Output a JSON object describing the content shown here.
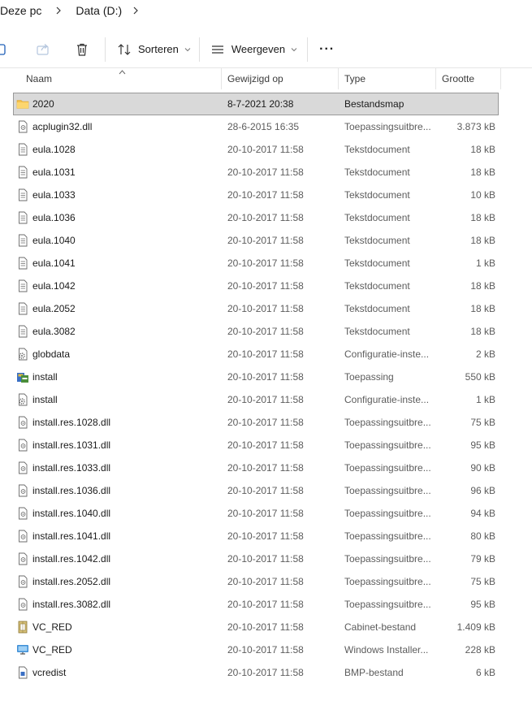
{
  "breadcrumb": {
    "items": [
      "Deze pc",
      "Data (D:)"
    ]
  },
  "toolbar": {
    "sort_label": "Sorteren",
    "view_label": "Weergeven",
    "more_label": "···"
  },
  "columns": {
    "name": "Naam",
    "modified": "Gewijzigd op",
    "type": "Type",
    "size": "Grootte"
  },
  "colors": {
    "folder": "#f5c04a",
    "selection": "#d9d9d9",
    "icon_gray": "#6b6b6b"
  },
  "files": [
    {
      "name": "2020",
      "modified": "8-7-2021 20:38",
      "type": "Bestandsmap",
      "size": "",
      "icon": "folder-icon",
      "selected": true
    },
    {
      "name": "acplugin32.dll",
      "modified": "28-6-2015 16:35",
      "type": "Toepassingsuitbre...",
      "size": "3.873 kB",
      "icon": "dll-file-icon"
    },
    {
      "name": "eula.1028",
      "modified": "20-10-2017 11:58",
      "type": "Tekstdocument",
      "size": "18 kB",
      "icon": "text-file-icon"
    },
    {
      "name": "eula.1031",
      "modified": "20-10-2017 11:58",
      "type": "Tekstdocument",
      "size": "18 kB",
      "icon": "text-file-icon"
    },
    {
      "name": "eula.1033",
      "modified": "20-10-2017 11:58",
      "type": "Tekstdocument",
      "size": "10 kB",
      "icon": "text-file-icon"
    },
    {
      "name": "eula.1036",
      "modified": "20-10-2017 11:58",
      "type": "Tekstdocument",
      "size": "18 kB",
      "icon": "text-file-icon"
    },
    {
      "name": "eula.1040",
      "modified": "20-10-2017 11:58",
      "type": "Tekstdocument",
      "size": "18 kB",
      "icon": "text-file-icon"
    },
    {
      "name": "eula.1041",
      "modified": "20-10-2017 11:58",
      "type": "Tekstdocument",
      "size": "1 kB",
      "icon": "text-file-icon"
    },
    {
      "name": "eula.1042",
      "modified": "20-10-2017 11:58",
      "type": "Tekstdocument",
      "size": "18 kB",
      "icon": "text-file-icon"
    },
    {
      "name": "eula.2052",
      "modified": "20-10-2017 11:58",
      "type": "Tekstdocument",
      "size": "18 kB",
      "icon": "text-file-icon"
    },
    {
      "name": "eula.3082",
      "modified": "20-10-2017 11:58",
      "type": "Tekstdocument",
      "size": "18 kB",
      "icon": "text-file-icon"
    },
    {
      "name": "globdata",
      "modified": "20-10-2017 11:58",
      "type": "Configuratie-inste...",
      "size": "2 kB",
      "icon": "config-file-icon"
    },
    {
      "name": "install",
      "modified": "20-10-2017 11:58",
      "type": "Toepassing",
      "size": "550 kB",
      "icon": "installer-app-icon"
    },
    {
      "name": "install",
      "modified": "20-10-2017 11:58",
      "type": "Configuratie-inste...",
      "size": "1 kB",
      "icon": "config-file-icon"
    },
    {
      "name": "install.res.1028.dll",
      "modified": "20-10-2017 11:58",
      "type": "Toepassingsuitbre...",
      "size": "75 kB",
      "icon": "dll-file-icon"
    },
    {
      "name": "install.res.1031.dll",
      "modified": "20-10-2017 11:58",
      "type": "Toepassingsuitbre...",
      "size": "95 kB",
      "icon": "dll-file-icon"
    },
    {
      "name": "install.res.1033.dll",
      "modified": "20-10-2017 11:58",
      "type": "Toepassingsuitbre...",
      "size": "90 kB",
      "icon": "dll-file-icon"
    },
    {
      "name": "install.res.1036.dll",
      "modified": "20-10-2017 11:58",
      "type": "Toepassingsuitbre...",
      "size": "96 kB",
      "icon": "dll-file-icon"
    },
    {
      "name": "install.res.1040.dll",
      "modified": "20-10-2017 11:58",
      "type": "Toepassingsuitbre...",
      "size": "94 kB",
      "icon": "dll-file-icon"
    },
    {
      "name": "install.res.1041.dll",
      "modified": "20-10-2017 11:58",
      "type": "Toepassingsuitbre...",
      "size": "80 kB",
      "icon": "dll-file-icon"
    },
    {
      "name": "install.res.1042.dll",
      "modified": "20-10-2017 11:58",
      "type": "Toepassingsuitbre...",
      "size": "79 kB",
      "icon": "dll-file-icon"
    },
    {
      "name": "install.res.2052.dll",
      "modified": "20-10-2017 11:58",
      "type": "Toepassingsuitbre...",
      "size": "75 kB",
      "icon": "dll-file-icon"
    },
    {
      "name": "install.res.3082.dll",
      "modified": "20-10-2017 11:58",
      "type": "Toepassingsuitbre...",
      "size": "95 kB",
      "icon": "dll-file-icon"
    },
    {
      "name": "VC_RED",
      "modified": "20-10-2017 11:58",
      "type": "Cabinet-bestand",
      "size": "1.409 kB",
      "icon": "cabinet-file-icon"
    },
    {
      "name": "VC_RED",
      "modified": "20-10-2017 11:58",
      "type": "Windows Installer...",
      "size": "228 kB",
      "icon": "msi-file-icon"
    },
    {
      "name": "vcredist",
      "modified": "20-10-2017 11:58",
      "type": "BMP-bestand",
      "size": "6 kB",
      "icon": "bmp-file-icon"
    }
  ]
}
